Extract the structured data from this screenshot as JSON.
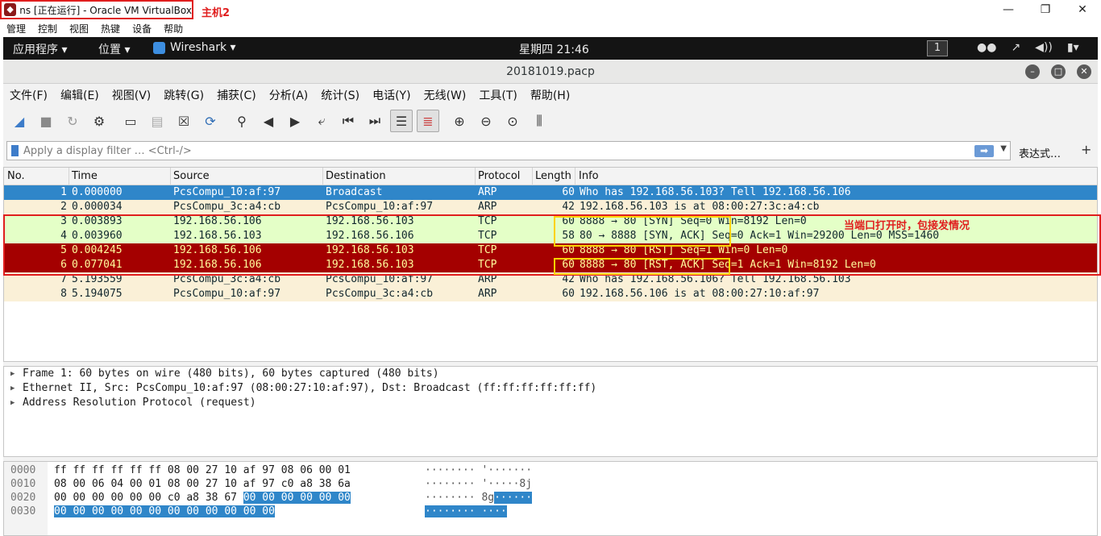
{
  "host": {
    "window_title": "ns [正在运行] - Oracle VM VirtualBox",
    "annotation": "主机2",
    "menu": [
      "管理",
      "控制",
      "视图",
      "热键",
      "设备",
      "帮助"
    ]
  },
  "gnome": {
    "apps": "应用程序 ▾",
    "places": "位置 ▾",
    "wireshark": "Wireshark ▾",
    "clock": "星期四 21:46",
    "workspace": "1"
  },
  "wireshark": {
    "title": "20181019.pacp",
    "menu": [
      "文件(F)",
      "编辑(E)",
      "视图(V)",
      "跳转(G)",
      "捕获(C)",
      "分析(A)",
      "统计(S)",
      "电话(Y)",
      "无线(W)",
      "工具(T)",
      "帮助(H)"
    ],
    "filter_placeholder": "Apply a display filter … <Ctrl-/>",
    "expression_button": "表达式…",
    "columns": [
      "No.",
      "Time",
      "Source",
      "Destination",
      "Protocol",
      "Length",
      "Info"
    ],
    "packets": [
      {
        "no": "1",
        "time": "0.000000",
        "src": "PcsCompu_10:af:97",
        "dst": "Broadcast",
        "proto": "ARP",
        "len": "60",
        "info": "Who has 192.168.56.103? Tell 192.168.56.106",
        "bg": "#2f86c9",
        "fg": "#ffffff"
      },
      {
        "no": "2",
        "time": "0.000034",
        "src": "PcsCompu_3c:a4:cb",
        "dst": "PcsCompu_10:af:97",
        "proto": "ARP",
        "len": "42",
        "info": "192.168.56.103 is at 08:00:27:3c:a4:cb",
        "bg": "#faf0d7",
        "fg": "#12272e"
      },
      {
        "no": "3",
        "time": "0.003893",
        "src": "192.168.56.106",
        "dst": "192.168.56.103",
        "proto": "TCP",
        "len": "60",
        "info": "8888 → 80 [SYN] Seq=0 Win=8192 Len=0",
        "bg": "#e4ffc7",
        "fg": "#12272e"
      },
      {
        "no": "4",
        "time": "0.003960",
        "src": "192.168.56.103",
        "dst": "192.168.56.106",
        "proto": "TCP",
        "len": "58",
        "info": "80 → 8888 [SYN, ACK] Seq=0 Ack=1 Win=29200 Len=0 MSS=1460",
        "bg": "#e4ffc7",
        "fg": "#12272e"
      },
      {
        "no": "5",
        "time": "0.004245",
        "src": "192.168.56.106",
        "dst": "192.168.56.103",
        "proto": "TCP",
        "len": "60",
        "info": "8888 → 80 [RST] Seq=1 Win=0 Len=0",
        "bg": "#a40000",
        "fg": "#fffc9c"
      },
      {
        "no": "6",
        "time": "0.077041",
        "src": "192.168.56.106",
        "dst": "192.168.56.103",
        "proto": "TCP",
        "len": "60",
        "info": "8888 → 80 [RST, ACK] Seq=1 Ack=1 Win=8192 Len=0",
        "bg": "#a40000",
        "fg": "#fffc9c"
      },
      {
        "no": "7",
        "time": "5.193559",
        "src": "PcsCompu_3c:a4:cb",
        "dst": "PcsCompu_10:af:97",
        "proto": "ARP",
        "len": "42",
        "info": "Who has 192.168.56.106? Tell 192.168.56.103",
        "bg": "#faf0d7",
        "fg": "#12272e"
      },
      {
        "no": "8",
        "time": "5.194075",
        "src": "PcsCompu_10:af:97",
        "dst": "PcsCompu_3c:a4:cb",
        "proto": "ARP",
        "len": "60",
        "info": "192.168.56.106 is at 08:00:27:10:af:97",
        "bg": "#faf0d7",
        "fg": "#12272e"
      }
    ],
    "annotation_text": "当端口打开时，包接发情况",
    "details": [
      "Frame 1: 60 bytes on wire (480 bits), 60 bytes captured (480 bits)",
      "Ethernet II, Src: PcsCompu_10:af:97 (08:00:27:10:af:97), Dst: Broadcast (ff:ff:ff:ff:ff:ff)",
      "Address Resolution Protocol (request)"
    ],
    "bytes": [
      {
        "offset": "0000",
        "hex": "ff ff ff ff ff ff 08 00  27 10 af 97 08 06 00 01",
        "hex_hl": "",
        "ascii": "········ '·······",
        "ascii_hl": ""
      },
      {
        "offset": "0010",
        "hex": "08 00 06 04 00 01 08 00  27 10 af 97 c0 a8 38 6a",
        "hex_hl": "",
        "ascii": "········ '·····8j",
        "ascii_hl": ""
      },
      {
        "offset": "0020",
        "hex": "00 00 00 00 00 00 c0 a8  38 67 ",
        "hex_hl": "00 00 00 00 00 00",
        "ascii": "········ 8g",
        "ascii_hl": "······"
      },
      {
        "offset": "0030",
        "hex": "",
        "hex_hl": "00 00 00 00 00 00 00 00  00 00 00 00",
        "ascii": "",
        "ascii_hl": "········ ····"
      }
    ]
  }
}
